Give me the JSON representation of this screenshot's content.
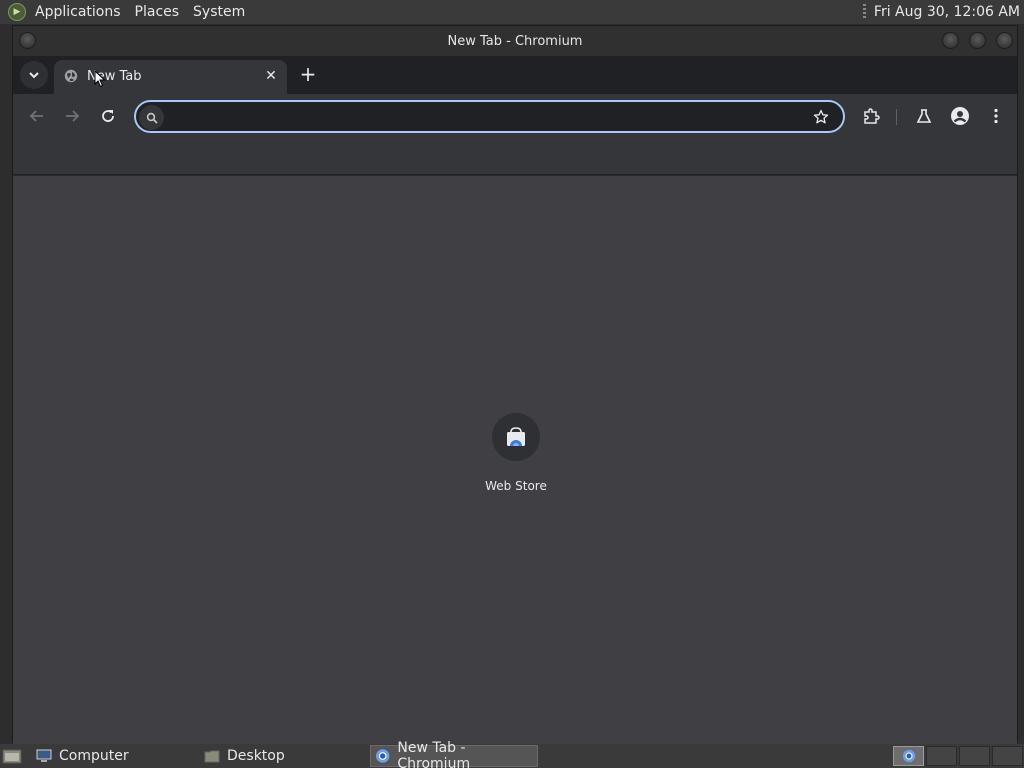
{
  "top_panel": {
    "menus": [
      "Applications",
      "Places",
      "System"
    ],
    "clock": "Fri Aug 30, 12:06 AM"
  },
  "window": {
    "title": "New Tab - Chromium"
  },
  "tab": {
    "title": "New Tab",
    "favicon": "globe-icon"
  },
  "omnibox": {
    "value": "",
    "placeholder": ""
  },
  "shortcuts": [
    {
      "label": "Web Store",
      "icon": "web-store-icon"
    }
  ],
  "taskbar": {
    "items": [
      "Computer",
      "Desktop",
      "New Tab - Chromium"
    ]
  },
  "colors": {
    "accent": "#a8c7fa",
    "content_bg": "#3f3f44",
    "toolbar_bg": "#35363a"
  }
}
